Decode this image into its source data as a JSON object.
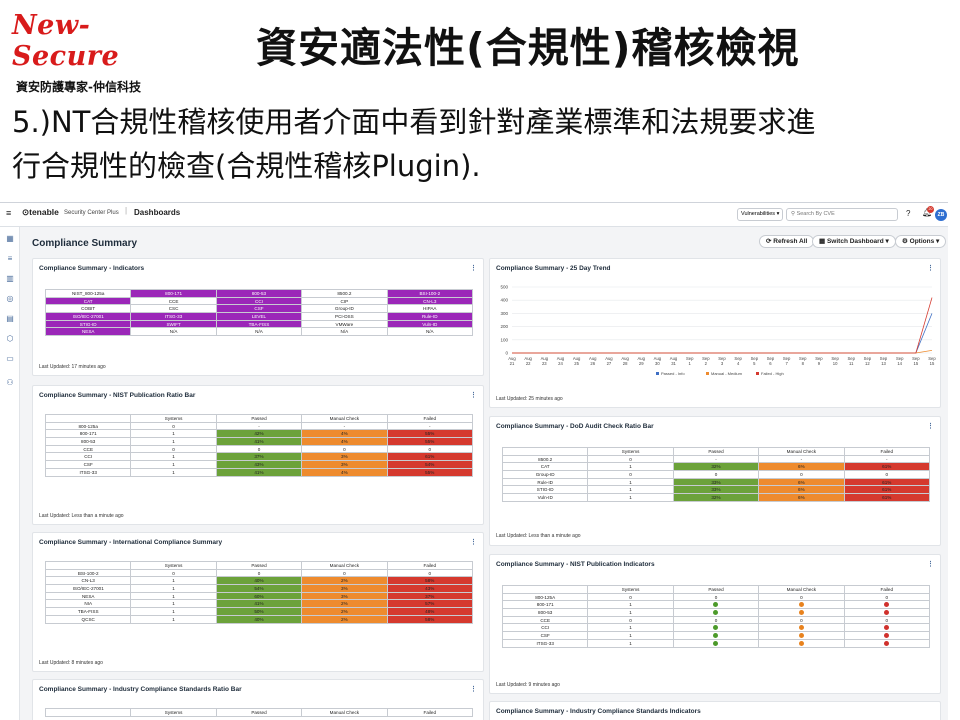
{
  "slide": {
    "logo_text": "New-Secure",
    "logo_sub": "資安防護專家-仲信科技",
    "title": "資安適法性(合規性)稽核檢視",
    "body_line1": "5.)NT合規性稽核使用者介面中看到針對產業標準和法規要求進",
    "body_line2": "行合規性的檢查(合規性稽核Plugin)."
  },
  "topbar": {
    "brand": "tenable",
    "product": "Security Center Plus",
    "section": "Dashboards",
    "vuln_select": "Vulnerabilities",
    "search_placeholder": "Search By CVE",
    "notif_count": "20",
    "avatar": "ZB"
  },
  "page": {
    "title": "Compliance Summary",
    "refresh_label": "Refresh All",
    "switch_label": "Switch Dashboard",
    "options_label": "Options"
  },
  "indicators": {
    "title": "Compliance Summary - Indicators",
    "updated": "Last Updated: 17 minutes ago",
    "rows": [
      [
        "NIST_800-125a",
        "800-171",
        "800-53",
        "8500.2",
        "BSI-100-2"
      ],
      [
        "CAT",
        "CCE",
        "CCI",
        "CIP",
        "CN-L3"
      ],
      [
        "COBIT",
        "CSC",
        "CSF",
        "Group-ID",
        "HIPAA"
      ],
      [
        "ISO/IEC-27001",
        "ITSG-33",
        "LEVEL",
        "PCI-DSS",
        "Rule-ID"
      ],
      [
        "STIG-ID",
        "SWIFT",
        "TBA-FISS",
        "VMWare",
        "Vuln-ID"
      ],
      [
        "NESA",
        "N/A",
        "N/A",
        "N/A",
        "N/A"
      ]
    ],
    "purple": [
      [
        0,
        1,
        1,
        0,
        1
      ],
      [
        1,
        0,
        1,
        0,
        1
      ],
      [
        0,
        0,
        1,
        0,
        0
      ],
      [
        1,
        1,
        1,
        0,
        1
      ],
      [
        1,
        1,
        1,
        0,
        1
      ],
      [
        1,
        0,
        0,
        0,
        0
      ]
    ]
  },
  "nist_ratio": {
    "title": "Compliance Summary - NIST Publication Ratio Bar",
    "updated": "Last Updated: Less than a minute ago",
    "headers": [
      "",
      "Systems",
      "Passed",
      "Manual Check",
      "Failed"
    ],
    "rows": [
      [
        "800-125a",
        "0",
        "-",
        "-",
        "-"
      ],
      [
        "800-171",
        "1",
        "42%",
        "4%",
        "55%"
      ],
      [
        "800-53",
        "1",
        "41%",
        "4%",
        "55%"
      ],
      [
        "CCE",
        "0",
        "0",
        "0",
        "0"
      ],
      [
        "CCI",
        "1",
        "37%",
        "3%",
        "61%"
      ],
      [
        "CSF",
        "1",
        "43%",
        "3%",
        "54%"
      ],
      [
        "ITSG-33",
        "1",
        "41%",
        "4%",
        "55%"
      ]
    ]
  },
  "intl": {
    "title": "Compliance Summary - International Compliance Summary",
    "updated": "Last Updated: 8 minutes ago",
    "headers": [
      "",
      "Systems",
      "Passed",
      "Manual Check",
      "Failed"
    ],
    "rows": [
      [
        "BSI-100-2",
        "0",
        "0",
        "0",
        "0"
      ],
      [
        "CN-L3",
        "1",
        "40%",
        "2%",
        "58%"
      ],
      [
        "ISO/IEC-27001",
        "1",
        "54%",
        "3%",
        "43%"
      ],
      [
        "NESA",
        "1",
        "60%",
        "3%",
        "37%"
      ],
      [
        "NIA",
        "1",
        "41%",
        "2%",
        "57%"
      ],
      [
        "TBA-FISS",
        "1",
        "50%",
        "2%",
        "48%"
      ],
      [
        "QCSC",
        "1",
        "40%",
        "2%",
        "58%"
      ]
    ]
  },
  "industry": {
    "title": "Compliance Summary - Industry Compliance Standards Ratio Bar",
    "headers": [
      "",
      "Systems",
      "Passed",
      "Manual Check",
      "Failed"
    ]
  },
  "trend": {
    "title": "Compliance Summary - 25 Day Trend",
    "updated": "Last Updated: 25 minutes ago",
    "legend": [
      "Passed - Info",
      "Manual - Medium",
      "Failed - High"
    ]
  },
  "chart_data": {
    "type": "line",
    "x": [
      "Aug 21",
      "Aug 22",
      "Aug 23",
      "Aug 24",
      "Aug 25",
      "Aug 26",
      "Aug 27",
      "Aug 28",
      "Aug 29",
      "Aug 30",
      "Aug 31",
      "Sep 1",
      "Sep 2",
      "Sep 3",
      "Sep 4",
      "Sep 5",
      "Sep 6",
      "Sep 7",
      "Sep 8",
      "Sep 9",
      "Sep 10",
      "Sep 11",
      "Sep 12",
      "Sep 13",
      "Sep 14",
      "Sep 15",
      "Sep 15"
    ],
    "yticks": [
      0,
      100,
      200,
      300,
      400,
      500
    ],
    "ylim": [
      0,
      500
    ],
    "series": [
      {
        "name": "Passed - Info",
        "color": "#3f6fc4",
        "values": [
          0,
          0,
          0,
          0,
          0,
          0,
          0,
          0,
          0,
          0,
          0,
          0,
          0,
          0,
          0,
          0,
          0,
          0,
          0,
          0,
          0,
          0,
          0,
          0,
          0,
          0,
          300
        ]
      },
      {
        "name": "Manual - Medium",
        "color": "#ee8b2e",
        "values": [
          0,
          0,
          0,
          0,
          0,
          0,
          0,
          0,
          0,
          0,
          0,
          0,
          0,
          0,
          0,
          0,
          0,
          0,
          0,
          0,
          0,
          0,
          0,
          0,
          0,
          0,
          20
        ]
      },
      {
        "name": "Failed - High",
        "color": "#d5392e",
        "values": [
          0,
          0,
          0,
          0,
          0,
          0,
          0,
          0,
          0,
          0,
          0,
          0,
          0,
          0,
          0,
          0,
          0,
          0,
          0,
          0,
          0,
          0,
          0,
          0,
          0,
          0,
          420
        ]
      }
    ]
  },
  "dod": {
    "title": "Compliance Summary - DoD Audit Check Ratio Bar",
    "updated": "Last Updated: Less than a minute ago",
    "headers": [
      "",
      "Systems",
      "Passed",
      "Manual Check",
      "Failed"
    ],
    "rows": [
      [
        "8500.2",
        "0",
        "-",
        "-",
        "-"
      ],
      [
        "CAT",
        "1",
        "32%",
        "6%",
        "61%"
      ],
      [
        "Group-ID",
        "0",
        "0",
        "0",
        "0"
      ],
      [
        "Rule-ID",
        "1",
        "33%",
        "6%",
        "61%"
      ],
      [
        "STIG-ID",
        "1",
        "33%",
        "6%",
        "61%"
      ],
      [
        "Vuln-ID",
        "1",
        "32%",
        "6%",
        "61%"
      ]
    ]
  },
  "nist_ind": {
    "title": "Compliance Summary - NIST Publication Indicators",
    "updated": "Last Updated: 9 minutes ago",
    "headers": [
      "",
      "Systems",
      "Passed",
      "Manual Check",
      "Failed"
    ],
    "rows": [
      [
        "800-125A",
        "0",
        "0",
        "0",
        "0"
      ],
      [
        "800-171",
        "1",
        "",
        "",
        ""
      ],
      [
        "800-53",
        "1",
        "",
        "",
        ""
      ],
      [
        "CCE",
        "0",
        "0",
        "0",
        "0"
      ],
      [
        "CCI",
        "1",
        "",
        "",
        ""
      ],
      [
        "CSF",
        "1",
        "",
        "",
        ""
      ],
      [
        "ITSG-33",
        "1",
        "",
        "",
        ""
      ]
    ]
  },
  "industry_ind": {
    "title": "Compliance Summary - Industry Compliance Standards Indicators"
  }
}
